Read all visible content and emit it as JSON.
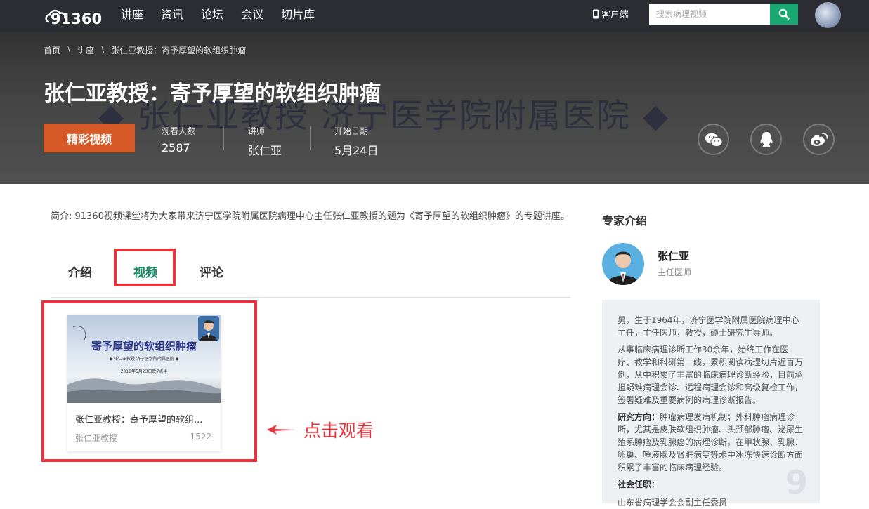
{
  "nav": {
    "logo": "91360",
    "links": [
      "讲座",
      "资讯",
      "论坛",
      "会议",
      "切片库"
    ],
    "client": "客户端",
    "search_placeholder": "搜索病理视频"
  },
  "hero": {
    "breadcrumb": [
      "首页",
      "\\",
      "讲座",
      "\\",
      "张仁亚教授：寄予厚望的软组织肿瘤"
    ],
    "bg_text": "◆ 张仁亚教授   济宁医学院附属医院 ◆",
    "title": "张仁亚教授：寄予厚望的软组织肿瘤",
    "button": "精彩视频",
    "stats": [
      {
        "label": "观看人数",
        "value": "2587"
      },
      {
        "label": "讲师",
        "value": "张仁亚"
      },
      {
        "label": "开始日期",
        "value": "5月24日"
      }
    ],
    "share_icons": [
      "wechat-icon",
      "qq-icon",
      "weibo-icon"
    ]
  },
  "intro": "简介: 91360视频课堂将为大家带来济宁医学院附属医院病理中心主任张仁亚教授的题为《寄予厚望的软组织肿瘤》的专题讲座。",
  "tabs": [
    {
      "label": "介绍",
      "active": false
    },
    {
      "label": "视频",
      "active": true
    },
    {
      "label": "评论",
      "active": false
    }
  ],
  "video_card": {
    "thumb_title": "寄予厚望的软组织肿瘤",
    "thumb_sub": "◆ 张仁亚教授   济宁医学院附属医院 ◆",
    "thumb_date": "2018年5月23日晚7点半",
    "title": "张仁亚教授：寄予厚望的软组...",
    "author": "张仁亚教授",
    "views": "1522"
  },
  "annotation": "点击观看",
  "sidebar": {
    "title": "专家介绍",
    "name": "张仁亚",
    "role": "主任医师",
    "bio_1": "男，生于1964年，济宁医学院附属医院病理中心主任，主任医师，教授，硕士研究生导师。",
    "bio_2": "从事临床病理诊断工作30余年，始终工作在医疗、教学和科研第一线，累积阅读病理切片近百万例，从中积累了丰富的临床病理诊断经验，目前承担疑难病理会诊、远程病理会诊和高级复检工作，签署疑难及重要病例的病理诊断报告。",
    "research_label": "研究方向：",
    "research": "肿瘤病理发病机制；外科肿瘤病理诊断，尤其是皮肤软组织肿瘤、头颈部肿瘤、泌尿生殖系肿瘤及乳腺癌的病理诊断，在甲状腺、乳腺、卵巢、唾液腺及肾脏病变等术中冰冻快速诊断方面积累了丰富的临床病理经验。",
    "social_label": "社会任职：",
    "social_partial": "山东省病理学会会副主任委员"
  },
  "colors": {
    "accent_green": "#1aa872",
    "orange": "#d65a28",
    "highlight_red": "#e8323c",
    "nav_bg": "#2b2d33"
  }
}
